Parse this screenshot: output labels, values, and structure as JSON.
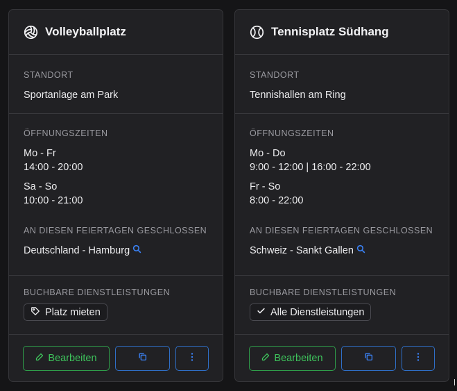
{
  "colors": {
    "background": "#151517",
    "card": "#212124",
    "edit_green": "#3ec45c",
    "action_blue": "#2f6fc7",
    "search_blue": "#3b82f6"
  },
  "cards": [
    {
      "title": "Volleyballplatz",
      "icon": "volleyball-icon",
      "location_label": "STANDORT",
      "location": "Sportanlage am Park",
      "hours_label": "ÖFFNUNGSZEITEN",
      "hours": [
        {
          "days": "Mo - Fr",
          "times": "14:00 - 20:00"
        },
        {
          "days": "Sa - So",
          "times": "10:00 - 21:00"
        }
      ],
      "holidays_label": "AN DIESEN FEIERTAGEN GESCHLOSSEN",
      "holidays": "Deutschland - Hamburg",
      "services_label": "BUCHBARE DIENSTLEISTUNGEN",
      "service": "Platz mieten",
      "service_icon": "tag-icon",
      "edit_label": "Bearbeiten"
    },
    {
      "title": "Tennisplatz Südhang",
      "icon": "tennis-ball-icon",
      "location_label": "STANDORT",
      "location": "Tennishallen am Ring",
      "hours_label": "ÖFFNUNGSZEITEN",
      "hours": [
        {
          "days": "Mo - Do",
          "times": "9:00 - 12:00 | 16:00 - 22:00"
        },
        {
          "days": "Fr - So",
          "times": "8:00 - 22:00"
        }
      ],
      "holidays_label": "AN DIESEN FEIERTAGEN GESCHLOSSEN",
      "holidays": "Schweiz - Sankt Gallen",
      "services_label": "BUCHBARE DIENSTLEISTUNGEN",
      "service": "Alle Dienstleistungen",
      "service_icon": "check-icon",
      "edit_label": "Bearbeiten"
    }
  ]
}
